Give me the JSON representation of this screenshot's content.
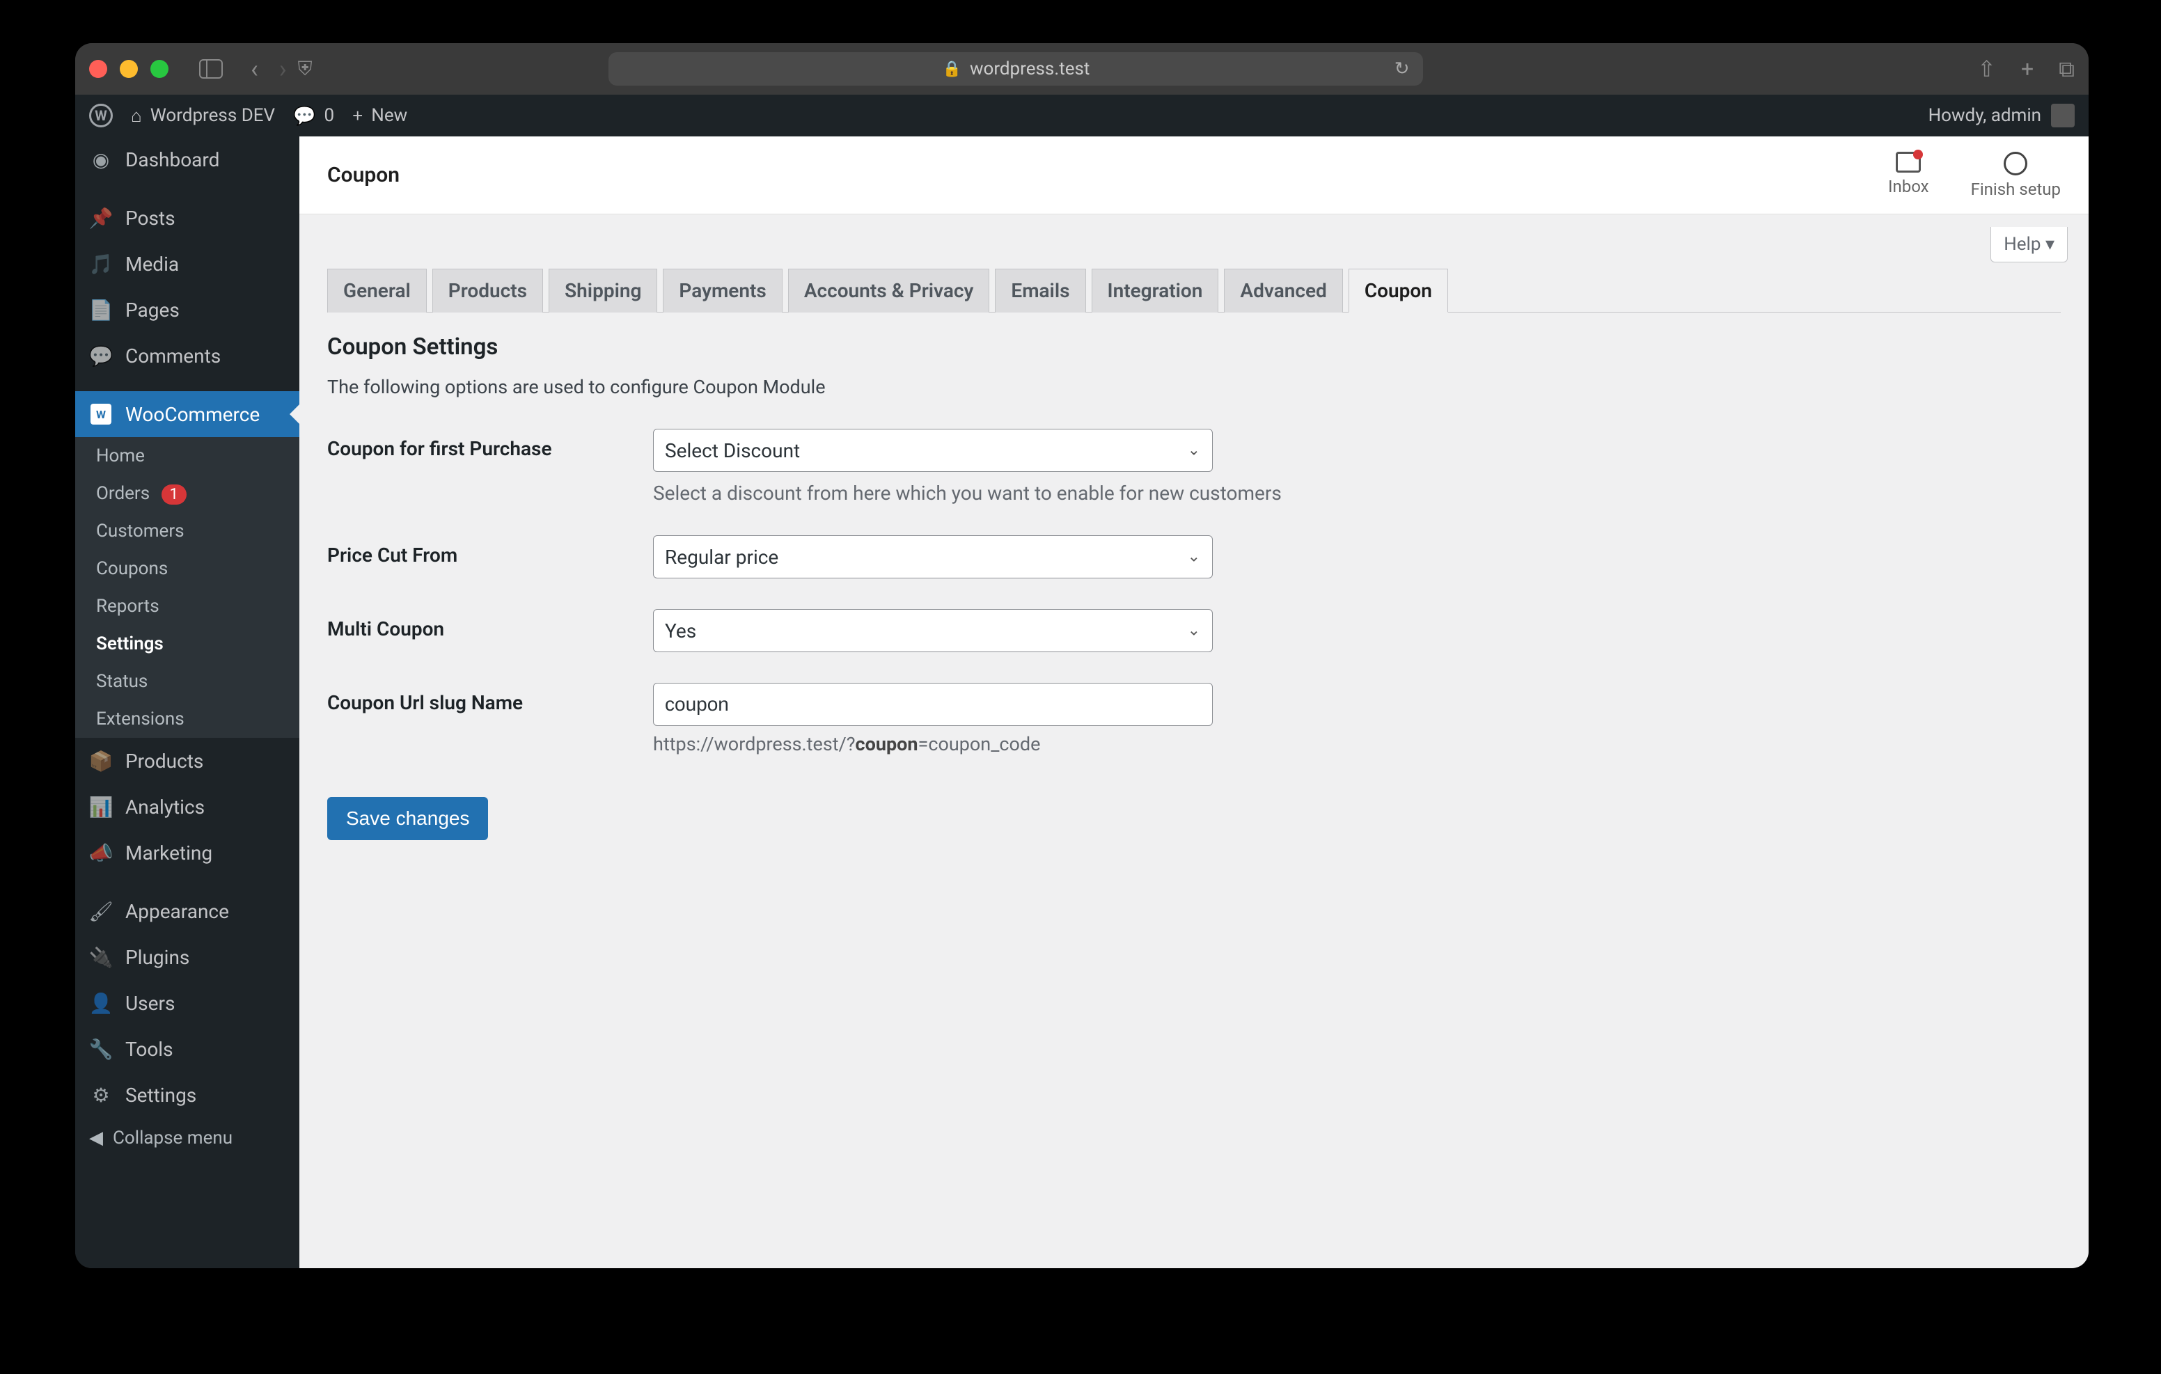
{
  "browser": {
    "url": "wordpress.test"
  },
  "adminbar": {
    "site_name": "Wordpress DEV",
    "comments_count": "0",
    "new_label": "New",
    "howdy": "Howdy, admin"
  },
  "sidebar": {
    "menu": [
      {
        "label": "Dashboard",
        "icon": "dashboard"
      },
      {
        "label": "Posts",
        "icon": "pin"
      },
      {
        "label": "Media",
        "icon": "media"
      },
      {
        "label": "Pages",
        "icon": "pages"
      },
      {
        "label": "Comments",
        "icon": "comments"
      }
    ],
    "woocommerce_label": "WooCommerce",
    "submenu": [
      {
        "label": "Home"
      },
      {
        "label": "Orders",
        "badge": "1"
      },
      {
        "label": "Customers"
      },
      {
        "label": "Coupons"
      },
      {
        "label": "Reports"
      },
      {
        "label": "Settings",
        "current": true
      },
      {
        "label": "Status"
      },
      {
        "label": "Extensions"
      }
    ],
    "menu_after": [
      {
        "label": "Products",
        "icon": "products"
      },
      {
        "label": "Analytics",
        "icon": "analytics"
      },
      {
        "label": "Marketing",
        "icon": "marketing"
      },
      {
        "label": "Appearance",
        "icon": "appearance"
      },
      {
        "label": "Plugins",
        "icon": "plugins"
      },
      {
        "label": "Users",
        "icon": "users"
      },
      {
        "label": "Tools",
        "icon": "tools"
      },
      {
        "label": "Settings",
        "icon": "settings"
      }
    ],
    "collapse": "Collapse menu"
  },
  "header": {
    "title": "Coupon",
    "inbox": "Inbox",
    "finish": "Finish setup",
    "help": "Help"
  },
  "tabs": [
    "General",
    "Products",
    "Shipping",
    "Payments",
    "Accounts & Privacy",
    "Emails",
    "Integration",
    "Advanced",
    "Coupon"
  ],
  "active_tab": "Coupon",
  "form": {
    "section_title": "Coupon Settings",
    "section_desc": "The following options are used to configure Coupon Module",
    "rows": {
      "first_purchase": {
        "label": "Coupon for first Purchase",
        "value": "Select Discount",
        "desc": "Select a discount from here which you want to enable for new customers"
      },
      "price_cut": {
        "label": "Price Cut From",
        "value": "Regular price"
      },
      "multi_coupon": {
        "label": "Multi Coupon",
        "value": "Yes"
      },
      "url_slug": {
        "label": "Coupon Url slug Name",
        "value": "coupon",
        "url_prefix": "https://wordpress.test/?",
        "url_bold": "coupon",
        "url_suffix": "=coupon_code"
      }
    },
    "save": "Save changes"
  }
}
